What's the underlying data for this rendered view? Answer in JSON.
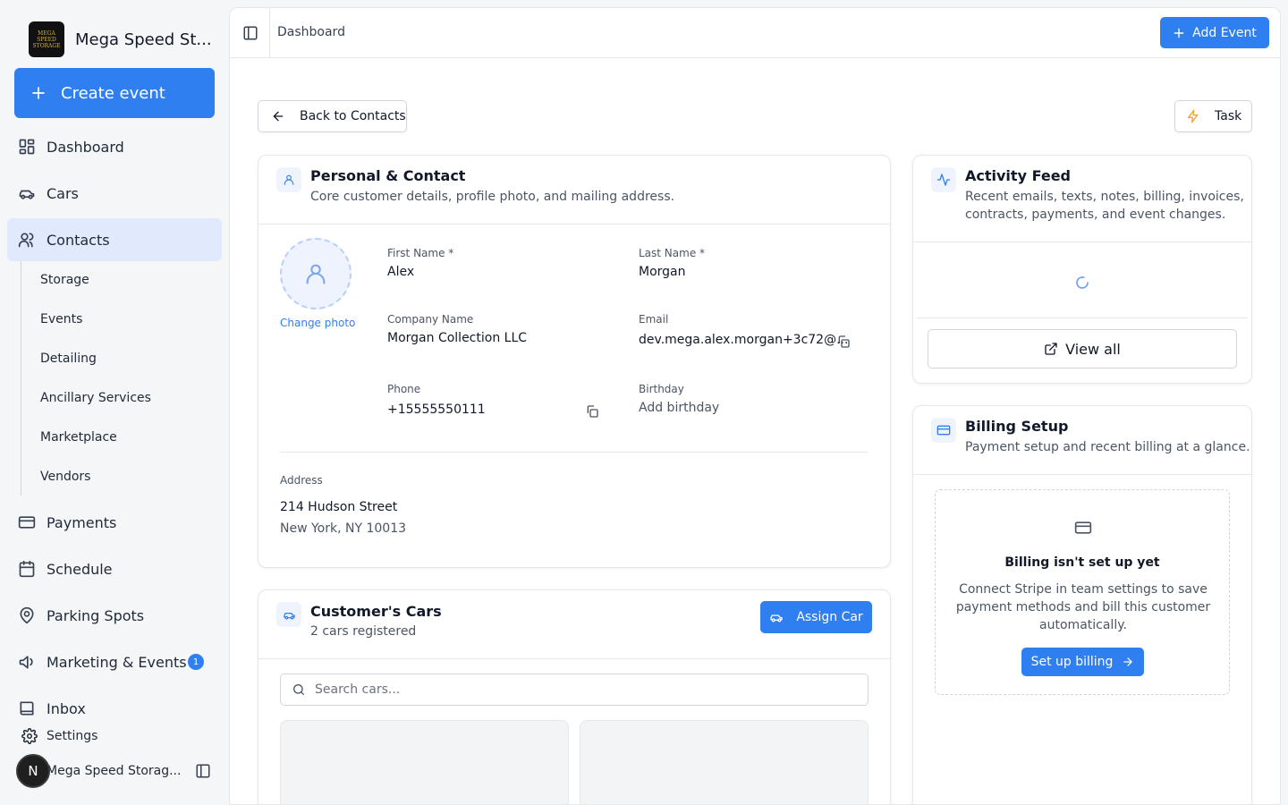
{
  "brand": {
    "name": "Mega Speed St...",
    "logo_text": "MEGA SPEED STORAGE"
  },
  "sidebar": {
    "create_label": "Create event",
    "items": [
      {
        "label": "Dashboard"
      },
      {
        "label": "Cars"
      },
      {
        "label": "Contacts"
      },
      {
        "label": "Payments"
      },
      {
        "label": "Schedule"
      },
      {
        "label": "Parking Spots"
      },
      {
        "label": "Marketing & Events",
        "badge": "1"
      },
      {
        "label": "Inbox"
      }
    ],
    "sub_items": [
      "Storage",
      "Events",
      "Detailing",
      "Ancillary Services",
      "Marketplace",
      "Vendors"
    ],
    "settings_label": "Settings",
    "user": {
      "initial": "N",
      "name": "Mega Speed Storag..."
    }
  },
  "topbar": {
    "breadcrumb": "Dashboard",
    "add_event_label": "Add Event"
  },
  "actions": {
    "back_label": "Back to Contacts",
    "task_label": "Task"
  },
  "personal": {
    "title": "Personal & Contact",
    "subtitle": "Core customer details, profile photo, and mailing address.",
    "change_photo": "Change photo",
    "first_name_label": "First Name *",
    "first_name": "Alex",
    "last_name_label": "Last Name *",
    "last_name": "Morgan",
    "company_label": "Company Name",
    "company": "Morgan Collection LLC",
    "email_label": "Email",
    "email": "dev.mega.alex.morgan+3c72@...",
    "phone_label": "Phone",
    "phone": "+15555550111",
    "birthday_label": "Birthday",
    "birthday": "Add birthday",
    "address_label": "Address",
    "address_line1": "214 Hudson Street",
    "address_line2": "New York, NY 10013"
  },
  "cars": {
    "title": "Customer's Cars",
    "subtitle": "2 cars registered",
    "assign_label": "Assign Car",
    "search_placeholder": "Search cars..."
  },
  "activity": {
    "title": "Activity Feed",
    "subtitle_line1": "Recent emails, texts, notes, billing, invoices,",
    "subtitle_line2": "contracts, payments, and event changes.",
    "view_all": "View all"
  },
  "billing": {
    "title": "Billing Setup",
    "subtitle": "Payment setup and recent billing at a glance.",
    "empty_title": "Billing isn't set up yet",
    "empty_desc": "Connect Stripe in team settings to save payment methods and bill this customer automatically.",
    "setup_label": "Set up billing"
  },
  "colors": {
    "accent": "#2f7ff0",
    "active_nav": "#e0eafc",
    "sidebar_bg": "#f5f6f8"
  }
}
